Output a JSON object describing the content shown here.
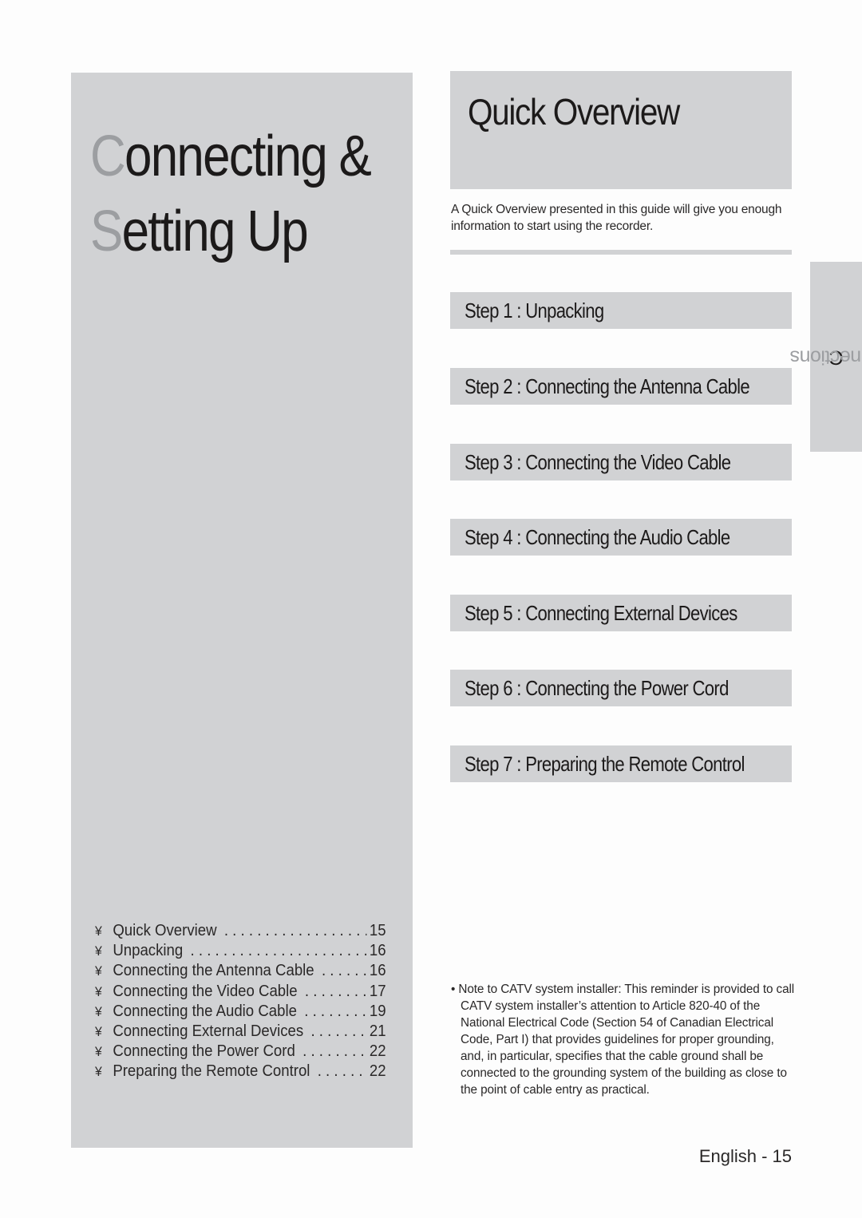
{
  "chapter": {
    "title_line1_initial": "C",
    "title_line1_rest": "onnecting &",
    "title_line2_initial": "S",
    "title_line2_rest": "etting Up"
  },
  "toc": {
    "bullet": "¥",
    "items": [
      {
        "label": "Quick Overview",
        "page": "15"
      },
      {
        "label": "Unpacking",
        "page": "16"
      },
      {
        "label": "Connecting the Antenna Cable",
        "page": "16"
      },
      {
        "label": "Connecting the Video Cable",
        "page": "17"
      },
      {
        "label": "Connecting the Audio Cable",
        "page": "19"
      },
      {
        "label": "Connecting External Devices",
        "page": "21"
      },
      {
        "label": "Connecting the Power Cord",
        "page": "22"
      },
      {
        "label": "Preparing the Remote Control",
        "page": "22"
      }
    ]
  },
  "quick_overview": {
    "title": "Quick Overview",
    "intro": "A Quick Overview presented in this guide will give you enough information to start using the recorder."
  },
  "steps": [
    {
      "label": "Step 1 : Unpacking"
    },
    {
      "label": "Step 2 : Connecting the Antenna Cable"
    },
    {
      "label": "Step 3 : Connecting the Video Cable"
    },
    {
      "label": "Step 4 : Connecting the Audio Cable"
    },
    {
      "label": "Step 5 : Connecting External Devices"
    },
    {
      "label": "Step 6 : Connecting the Power Cord"
    },
    {
      "label": "Step 7 : Preparing the Remote Control"
    }
  ],
  "side_tab": {
    "initial": "C",
    "rest": "onnections"
  },
  "note": {
    "bullet": "•",
    "text": "Note to CATV system installer: This reminder is provided to call CATV system installer’s attention to Article 820-40 of the National Electrical Code (Section 54 of Canadian Electrical Code, Part I) that provides guidelines for proper grounding, and, in particular, specifies that the cable ground shall be connected to the grounding system of the building as close to the point of cable entry as practical."
  },
  "footer": {
    "page_label": "English - 15"
  }
}
